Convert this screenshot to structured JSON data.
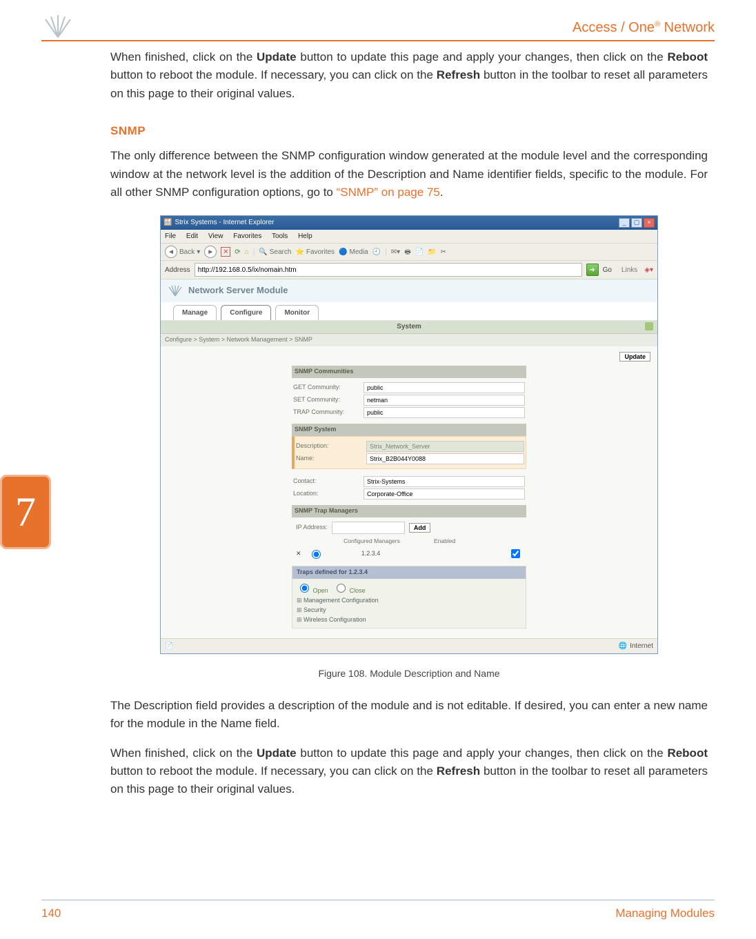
{
  "header": {
    "brand_html": "Access / One® Network"
  },
  "chapter": {
    "number": "7"
  },
  "body": {
    "p1_pre": "When finished, click on the ",
    "p1_b1": "Update",
    "p1_mid1": " button to update this page and apply your changes, then click on the ",
    "p1_b2": "Reboot",
    "p1_mid2": " button to reboot the module. If necessary, you can click on the ",
    "p1_b3": "Refresh",
    "p1_end": " button in the toolbar to reset all parameters on this page to their original values.",
    "h_snmp": "SNMP",
    "p2_pre": "The only difference between the SNMP configuration window generated at the module level and the corresponding window at the network level is the addition of the Description and Name identifier fields, specific to the module. For all other SNMP configuration options, go to ",
    "p2_link": "“SNMP” on page 75",
    "p2_end": ".",
    "fig_caption": "Figure 108. Module Description and Name",
    "p3": "The Description field provides a description of the module and is not editable. If desired, you can enter a new name for the module in the Name field.",
    "p4_pre": "When finished, click on the ",
    "p4_b1": "Update",
    "p4_mid1": " button to update this page and apply your changes, then click on the ",
    "p4_b2": "Reboot",
    "p4_mid2": " button to reboot the module. If necessary, you can click on the ",
    "p4_b3": "Refresh",
    "p4_end": " button in the toolbar to reset all parameters on this page to their original values."
  },
  "ie": {
    "title": "Strix Systems - Internet Explorer",
    "menus": {
      "file": "File",
      "edit": "Edit",
      "view": "View",
      "fav": "Favorites",
      "tools": "Tools",
      "help": "Help"
    },
    "tb": {
      "back": "Back",
      "search": "Search",
      "favorites": "Favorites",
      "media": "Media"
    },
    "addr_label": "Address",
    "addr_value": "http://192.168.0.5/ix/nomain.htm",
    "go": "Go",
    "links": "Links",
    "app_title": "Network Server Module",
    "tabs": {
      "manage": "Manage",
      "configure": "Configure",
      "monitor": "Monitor"
    },
    "subtab": "System",
    "breadcrumb": "Configure > System > Network Management > SNMP",
    "update": "Update",
    "groups": {
      "communities": {
        "title": "SNMP Communities",
        "get_lbl": "GET Community:",
        "get_val": "public",
        "set_lbl": "SET Community:",
        "set_val": "netman",
        "trap_lbl": "TRAP Community:",
        "trap_val": "public"
      },
      "system": {
        "title": "SNMP System",
        "desc_lbl": "Description:",
        "desc_val": "Strix_Network_Server",
        "name_lbl": "Name:",
        "name_val": "Strix_B2B044Y0088",
        "contact_lbl": "Contact:",
        "contact_val": "Strix-Systems",
        "loc_lbl": "Location:",
        "loc_val": "Corporate-Office"
      },
      "trapmgr": {
        "title": "SNMP Trap Managers",
        "ip_lbl": "IP Address:",
        "add": "Add",
        "col_cm": "Configured Managers",
        "col_en": "Enabled",
        "entry": "1.2.3.4"
      },
      "traps": {
        "title": "Traps defined for 1.2.3.4",
        "open": "Open",
        "close": "Close",
        "items": {
          "a": "Management Configuration",
          "b": "Security",
          "c": "Wireless Configuration"
        }
      }
    },
    "status": "Internet"
  },
  "footer": {
    "page": "140",
    "section": "Managing Modules"
  }
}
